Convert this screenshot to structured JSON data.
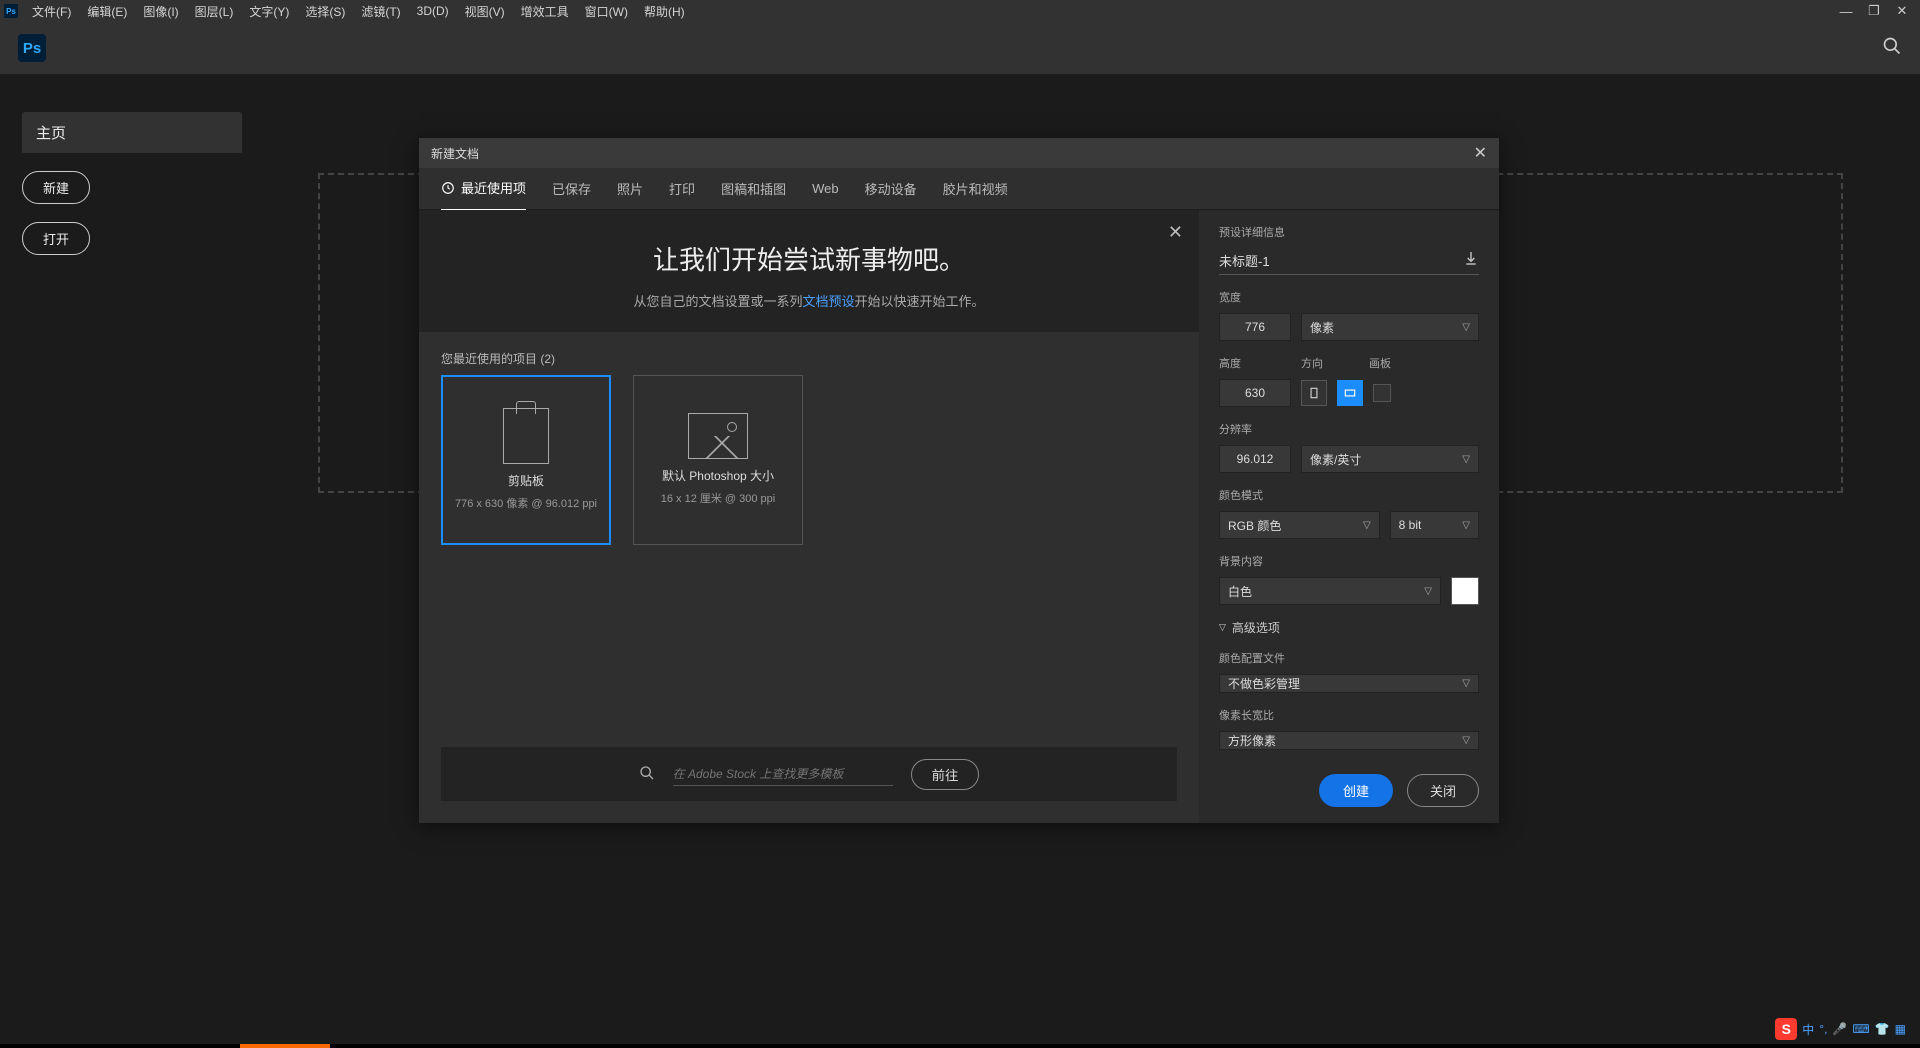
{
  "menubar": {
    "items": [
      "文件(F)",
      "编辑(E)",
      "图像(I)",
      "图层(L)",
      "文字(Y)",
      "选择(S)",
      "滤镜(T)",
      "3D(D)",
      "视图(V)",
      "增效工具",
      "窗口(W)",
      "帮助(H)"
    ]
  },
  "home": {
    "tab": "主页",
    "new_btn": "新建",
    "open_btn": "打开"
  },
  "dialog": {
    "title": "新建文档",
    "tabs": [
      "最近使用项",
      "已保存",
      "照片",
      "打印",
      "图稿和插图",
      "Web",
      "移动设备",
      "胶片和视频"
    ],
    "hero_title": "让我们开始尝试新事物吧。",
    "hero_text_pre": "从您自己的文档设置或一系列",
    "hero_link": "文档预设",
    "hero_text_post": "开始以快速开始工作。",
    "recent_label": "您最近使用的项目 (2)",
    "presets": [
      {
        "title": "剪贴板",
        "sub": "776 x 630 像素 @ 96.012 ppi"
      },
      {
        "title": "默认 Photoshop 大小",
        "sub": "16 x 12 厘米 @ 300 ppi"
      }
    ],
    "stock_placeholder": "在 Adobe Stock 上查找更多模板",
    "stock_go": "前往"
  },
  "details": {
    "section": "预设详细信息",
    "name": "未标题-1",
    "width_label": "宽度",
    "width": "776",
    "width_unit": "像素",
    "height_label": "高度",
    "orient_label": "方向",
    "artboard_label": "画板",
    "height": "630",
    "res_label": "分辨率",
    "res": "96.012",
    "res_unit": "像素/英寸",
    "mode_label": "颜色模式",
    "mode": "RGB 颜色",
    "bits": "8 bit",
    "bg_label": "背景内容",
    "bg": "白色",
    "advanced": "高级选项",
    "profile_label": "颜色配置文件",
    "profile": "不做色彩管理",
    "aspect_label": "像素长宽比",
    "aspect": "方形像素",
    "create": "创建",
    "close": "关闭"
  },
  "ime": {
    "lang": "中"
  }
}
